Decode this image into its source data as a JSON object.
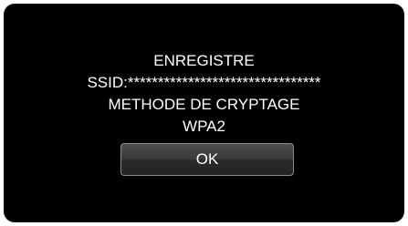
{
  "dialog": {
    "title": "ENREGISTRE",
    "ssid_line": "SSID:********************************",
    "encryption_label": "METHODE DE CRYPTAGE",
    "encryption_value": "WPA2",
    "ok_label": "OK"
  }
}
